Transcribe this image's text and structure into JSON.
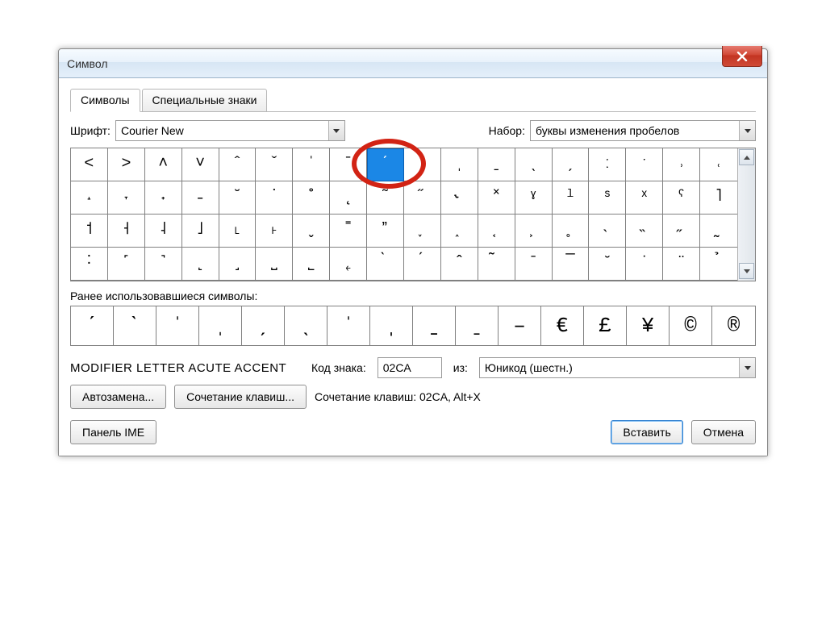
{
  "title": "Символ",
  "closeGlyph": "X",
  "tabs": {
    "symbols": "Символы",
    "special": "Специальные знаки"
  },
  "labels": {
    "font": "Шрифт:",
    "subset": "Набор:",
    "recent": "Ранее использовавшиеся символы:",
    "charCode": "Код знака:",
    "from": "из:"
  },
  "fontSelect": "Courier New",
  "subsetSelect": "буквы изменения пробелов",
  "grid": [
    "˂",
    "˃",
    "˄",
    "˅",
    "ˆ",
    "ˇ",
    "ˈ",
    "ˉ",
    "ˊ",
    "ˋ",
    "ˌ",
    "ˍ",
    "ˎ",
    "ˏ",
    "ː",
    "ˑ",
    "˒",
    "˓",
    "˔",
    "˕",
    "˖",
    "˗",
    "˘",
    "˙",
    "˚",
    "˛",
    "˜",
    "˝",
    "˞",
    "˟",
    "ˠ",
    "ˡ",
    "ˢ",
    "ˣ",
    "ˤ",
    "˥",
    "˦",
    "˧",
    "˨",
    "˩",
    "˪",
    "˫",
    "ˬ",
    "˭",
    "ˮ",
    "˯",
    "˰",
    "˱",
    "˲",
    "˳",
    "˴",
    "˵",
    "˶",
    "˷",
    "˸",
    "˹",
    "˺",
    "˻",
    "˼",
    "˽",
    "˾",
    "˿",
    "̀",
    "́",
    "̂",
    "̃",
    "̄",
    "̅",
    "̆",
    "̇",
    "̈",
    "̉"
  ],
  "gridSelectedIndex": 8,
  "recent": [
    "ˊ",
    "ˋ",
    "ˈ",
    "ˌ",
    "̗",
    "̖",
    "̍",
    "̩",
    "̠",
    "̱",
    "–",
    "€",
    "£",
    "¥",
    "©",
    "®"
  ],
  "charName": "MODIFIER LETTER ACUTE ACCENT",
  "charCode": "02CA",
  "fromSelect": "Юникод (шестн.)",
  "buttons": {
    "autocorrect": "Автозамена...",
    "shortcut": "Сочетание клавиш...",
    "ime": "Панель IME",
    "insert": "Вставить",
    "cancel": "Отмена"
  },
  "shortcutInfo": "Сочетание клавиш: 02CA, Alt+X"
}
